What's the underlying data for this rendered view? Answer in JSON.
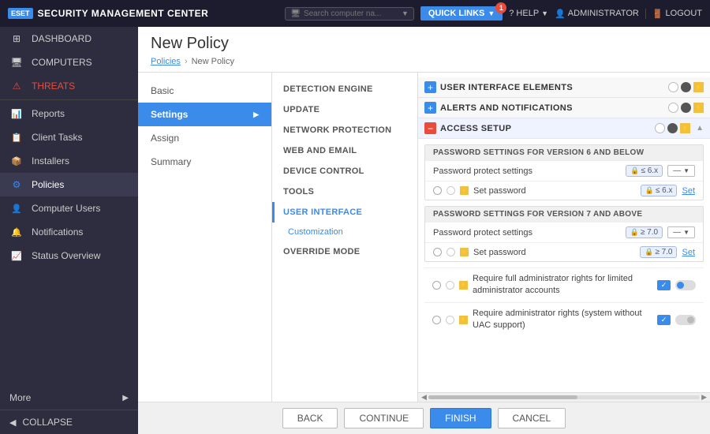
{
  "topbar": {
    "logo_text": "ESET",
    "title": "SECURITY MANAGEMENT CENTER",
    "search_placeholder": "Search computer na...",
    "quick_links": "QUICK LINKS",
    "quick_links_badge": "1",
    "help": "HELP",
    "admin": "ADMINISTRATOR",
    "logout": "LOGOUT"
  },
  "sidebar": {
    "items": [
      {
        "id": "dashboard",
        "label": "DASHBOARD",
        "icon": "⊞"
      },
      {
        "id": "computers",
        "label": "COMPUTERS",
        "icon": "🖥"
      },
      {
        "id": "threats",
        "label": "THREATS",
        "icon": "⚠"
      },
      {
        "id": "reports",
        "label": "Reports",
        "icon": "📊"
      },
      {
        "id": "client-tasks",
        "label": "Client Tasks",
        "icon": "📋"
      },
      {
        "id": "installers",
        "label": "Installers",
        "icon": "📦"
      },
      {
        "id": "policies",
        "label": "Policies",
        "icon": "⚙",
        "active": true
      },
      {
        "id": "computer-users",
        "label": "Computer Users",
        "icon": "👤"
      },
      {
        "id": "notifications",
        "label": "Notifications",
        "icon": "🔔"
      },
      {
        "id": "status-overview",
        "label": "Status Overview",
        "icon": "📈"
      }
    ],
    "more": "More",
    "collapse": "COLLAPSE"
  },
  "content": {
    "title": "New Policy",
    "breadcrumb_policies": "Policies",
    "breadcrumb_current": "New Policy"
  },
  "policy_nav": {
    "items": [
      {
        "id": "basic",
        "label": "Basic"
      },
      {
        "id": "settings",
        "label": "Settings",
        "active": true
      },
      {
        "id": "assign",
        "label": "Assign"
      },
      {
        "id": "summary",
        "label": "Summary"
      }
    ]
  },
  "mid_panel": {
    "items": [
      {
        "id": "detection-engine",
        "label": "DETECTION ENGINE"
      },
      {
        "id": "update",
        "label": "UPDATE"
      },
      {
        "id": "network-protection",
        "label": "NETWORK PROTECTION"
      },
      {
        "id": "web-and-email",
        "label": "WEB AND EMAIL"
      },
      {
        "id": "device-control",
        "label": "DEVICE CONTROL"
      },
      {
        "id": "tools",
        "label": "TOOLS"
      },
      {
        "id": "user-interface",
        "label": "USER INTERFACE",
        "active": true
      },
      {
        "id": "customization",
        "label": "Customization",
        "sub": true
      },
      {
        "id": "override-mode",
        "label": "OVERRIDE MODE"
      }
    ]
  },
  "right_panel": {
    "sections": [
      {
        "id": "user-interface-elements",
        "title": "USER INTERFACE ELEMENTS",
        "type": "plus",
        "expanded": false
      },
      {
        "id": "alerts-and-notifications",
        "title": "ALERTS AND NOTIFICATIONS",
        "type": "plus",
        "expanded": false
      },
      {
        "id": "access-setup",
        "title": "ACCESS SETUP",
        "type": "minus",
        "expanded": true
      }
    ],
    "pw_v6": {
      "title": "PASSWORD SETTINGS FOR VERSION 6 AND BELOW",
      "protect_label": "Password protect settings",
      "protect_tag": "≤ 6.x",
      "set_label": "Set password",
      "set_tag": "≤ 6.x",
      "set_link": "Set"
    },
    "pw_v7": {
      "title": "PASSWORD SETTINGS FOR VERSION 7 AND ABOVE",
      "protect_label": "Password protect settings",
      "protect_tag": "≥ 7.0",
      "set_label": "Set password",
      "set_tag": "≥ 7.0",
      "set_link": "Set"
    },
    "require_admin": {
      "label": "Require full administrator rights for limited administrator accounts"
    },
    "require_uac": {
      "label": "Require administrator rights (system without UAC support)"
    }
  },
  "footer": {
    "back": "BACK",
    "continue": "CONTINUE",
    "finish": "FINISH",
    "cancel": "CANCEL"
  }
}
